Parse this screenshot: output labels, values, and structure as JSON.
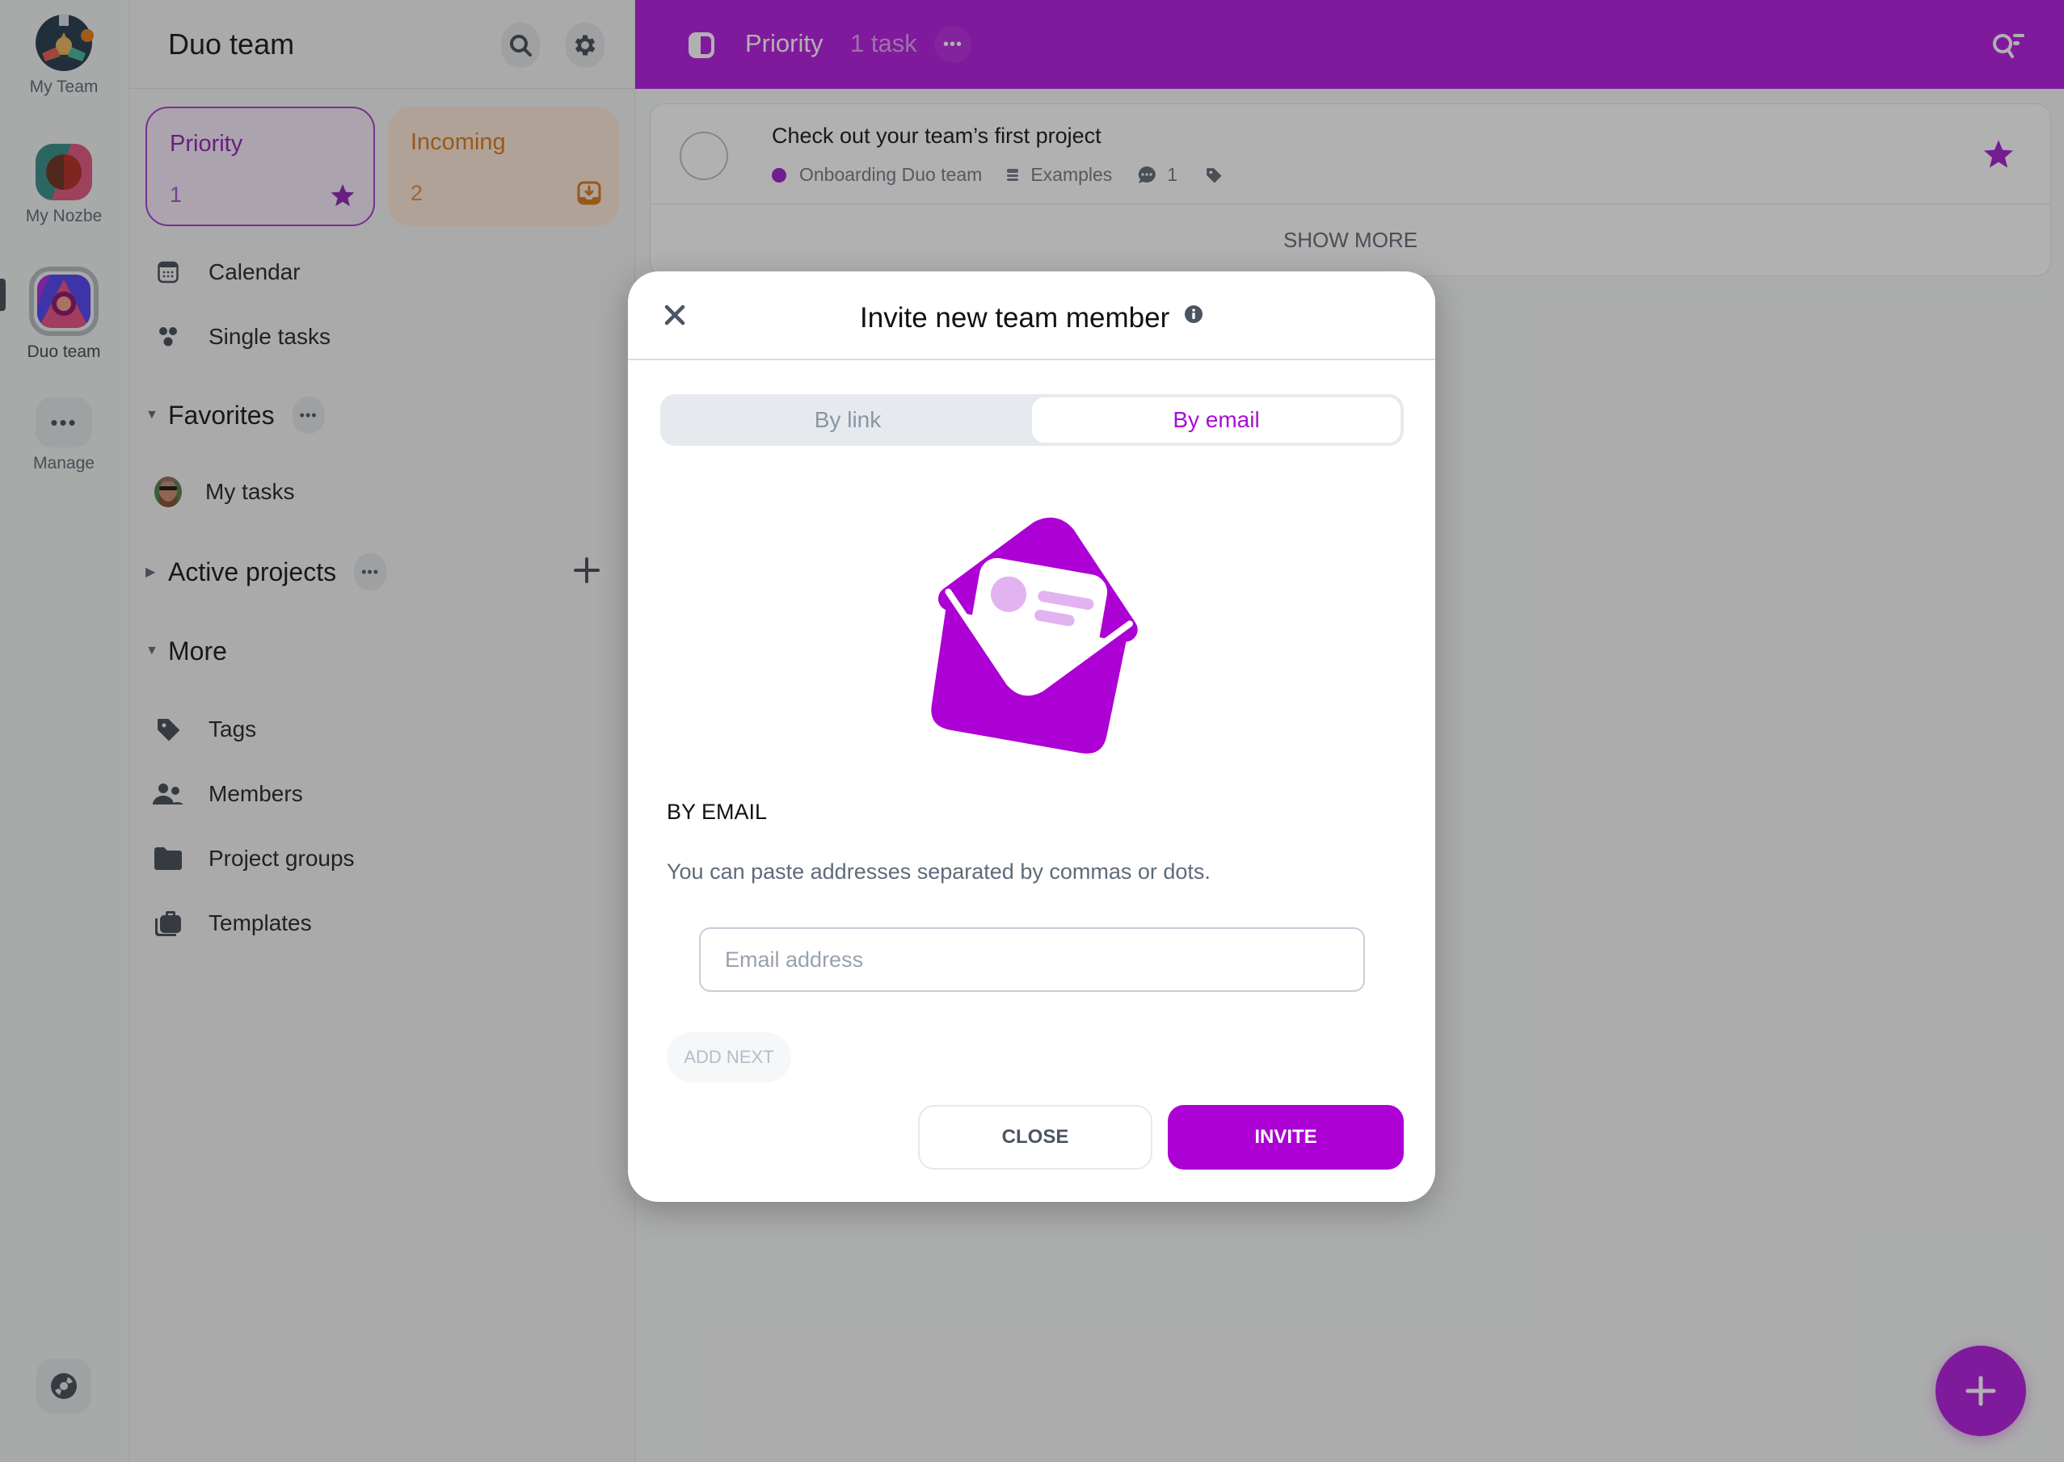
{
  "colors": {
    "accent": "#b314e0",
    "accent_strong": "#ad00d4",
    "incoming": "#d87516",
    "project_dot": "#9a1cc9"
  },
  "rail": {
    "items": [
      {
        "label": "My Team",
        "icon": "team-hands-avatar",
        "has_badge": true
      },
      {
        "label": "My Nozbe",
        "icon": "nozbe-avatar"
      },
      {
        "label": "Duo team",
        "icon": "duo-team-avatar",
        "active": true
      },
      {
        "label": "Manage",
        "icon": "more-dots-icon"
      }
    ],
    "bottom_icon": "lifebuoy-icon"
  },
  "sidebar": {
    "title": "Duo team",
    "header_buttons": [
      "search-icon",
      "gear-icon"
    ],
    "cards": {
      "priority": {
        "label": "Priority",
        "count": "1",
        "icon": "star-icon"
      },
      "incoming": {
        "label": "Incoming",
        "count": "2",
        "icon": "inbox-download-icon"
      }
    },
    "top_items": [
      {
        "label": "Calendar",
        "icon": "calendar-icon"
      },
      {
        "label": "Single tasks",
        "icon": "single-tasks-icon"
      }
    ],
    "sections": {
      "favorites": {
        "label": "Favorites",
        "expanded": true
      },
      "active_projects": {
        "label": "Active projects",
        "expanded": false
      },
      "more": {
        "label": "More",
        "expanded": true
      }
    },
    "favorites_items": [
      {
        "label": "My tasks",
        "icon": "user-avatar"
      }
    ],
    "more_items": [
      {
        "label": "Tags",
        "icon": "tag-icon"
      },
      {
        "label": "Members",
        "icon": "members-icon"
      },
      {
        "label": "Project groups",
        "icon": "folder-icon"
      },
      {
        "label": "Templates",
        "icon": "templates-icon"
      }
    ]
  },
  "main": {
    "header": {
      "title": "Priority",
      "count": "1 task"
    },
    "tasks": [
      {
        "name": "Check out your team’s first project",
        "project": "Onboarding Duo team",
        "section": "Examples",
        "comments": "1",
        "starred": true
      }
    ],
    "show_more": "SHOW MORE"
  },
  "modal": {
    "title": "Invite new team member",
    "tabs": [
      {
        "label": "By link",
        "active": false
      },
      {
        "label": "By email",
        "active": true
      }
    ],
    "heading": "BY EMAIL",
    "help_text": "You can paste addresses separated by commas or dots.",
    "email_input": {
      "value": "",
      "placeholder": "Email address"
    },
    "add_next_label": "ADD NEXT",
    "close_label": "CLOSE",
    "invite_label": "INVITE"
  }
}
